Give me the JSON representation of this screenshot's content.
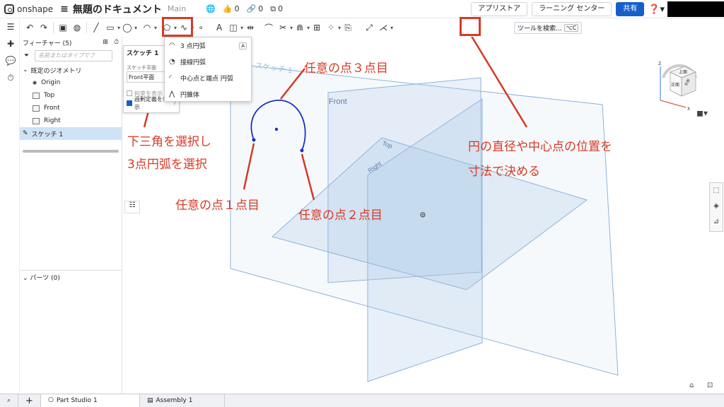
{
  "header": {
    "app_name": "onshape",
    "document_title": "無題のドキュメント",
    "branch": "Main",
    "like_count": "0",
    "link_count": "0",
    "copy_count": "0",
    "appstore_label": "アプリストア",
    "learning_label": "ラーニング センター",
    "share_label": "共有"
  },
  "toolbar": {
    "search_label": "ツールを検索...",
    "search_shortcut": "⌥C"
  },
  "feature_tree": {
    "title": "フィーチャー (5)",
    "filter_placeholder": "名前またはタイプでフ",
    "default_geometry": "既定のジオメトリ",
    "items": [
      {
        "label": "Origin"
      },
      {
        "label": "Top"
      },
      {
        "label": "Front"
      },
      {
        "label": "Right"
      }
    ],
    "sketch_label": "スケッチ 1",
    "parts_label": "パーツ (0)"
  },
  "sketch_panel": {
    "title": "スケッチ 1",
    "plane_label": "スケッチ平面",
    "plane_value": "Front平面",
    "constraint_label": "拘束を表示",
    "overdefined_label": "過剰定義を表示"
  },
  "arc_dropdown": {
    "items": [
      {
        "label": "3 点円弧",
        "shortcut": "A"
      },
      {
        "label": "接線円弧",
        "shortcut": ""
      },
      {
        "label": "中心点と端点 円弧",
        "shortcut": ""
      },
      {
        "label": "円錐体",
        "shortcut": ""
      }
    ]
  },
  "viewport": {
    "plane_front": "Front",
    "plane_top": "Top",
    "plane_right": "Right",
    "sketch_ghost": "スケッチ 1",
    "viewcube_top": "上面",
    "viewcube_front": "正面",
    "viewcube_right": "右側",
    "axis_x": "X",
    "axis_z": "Z"
  },
  "annotations": {
    "select_arc_line1": "下三角を選択し",
    "select_arc_line2": "3点円弧を選択",
    "point1": "任意の点１点目",
    "point2": "任意の点２点目",
    "point3": "任意の点３点目",
    "dimension_line1": "円の直径や中心点の位置を",
    "dimension_line2": "寸法で決める"
  },
  "bottom_tabs": [
    {
      "label": "Part Studio 1"
    },
    {
      "label": "Assembly 1"
    }
  ],
  "colors": {
    "annotation_red": "#d63a26",
    "plane_blue": "#8fb3d9",
    "sketch_blue": "#1a2fc4",
    "share_blue": "#1560c8"
  }
}
